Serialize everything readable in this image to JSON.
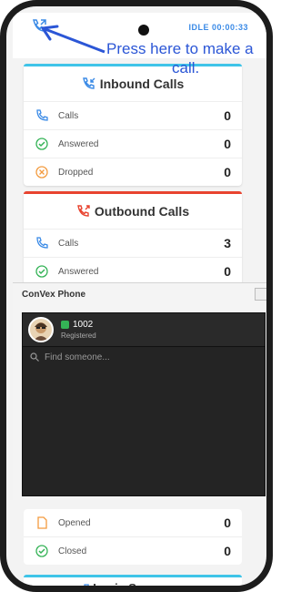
{
  "status": {
    "idle": "IDLE 00:00:33"
  },
  "hint": {
    "line1": "Press here to make a",
    "line2": "call."
  },
  "inbound": {
    "title": "Inbound Calls",
    "rows": [
      {
        "label": "Calls",
        "value": "0"
      },
      {
        "label": "Answered",
        "value": "0"
      },
      {
        "label": "Dropped",
        "value": "0"
      }
    ]
  },
  "outbound": {
    "title": "Outbound Calls",
    "rows": [
      {
        "label": "Calls",
        "value": "3"
      },
      {
        "label": "Answered",
        "value": "0"
      }
    ]
  },
  "convex": {
    "title": "ConVex Phone",
    "extension": "1002",
    "registration": "Registered",
    "search_placeholder": "Find someone..."
  },
  "tickets": {
    "rows": [
      {
        "label": "Opened",
        "value": "0"
      },
      {
        "label": "Closed",
        "value": "0"
      }
    ]
  },
  "login": {
    "title": "Login Summary"
  },
  "colors": {
    "accent_blue": "#3a8ae6",
    "inbound_top": "#3fc4e8",
    "outbound_top": "#e8432f",
    "green": "#34b356",
    "orange": "#f39b3f",
    "hint_blue": "#2b56d6"
  }
}
